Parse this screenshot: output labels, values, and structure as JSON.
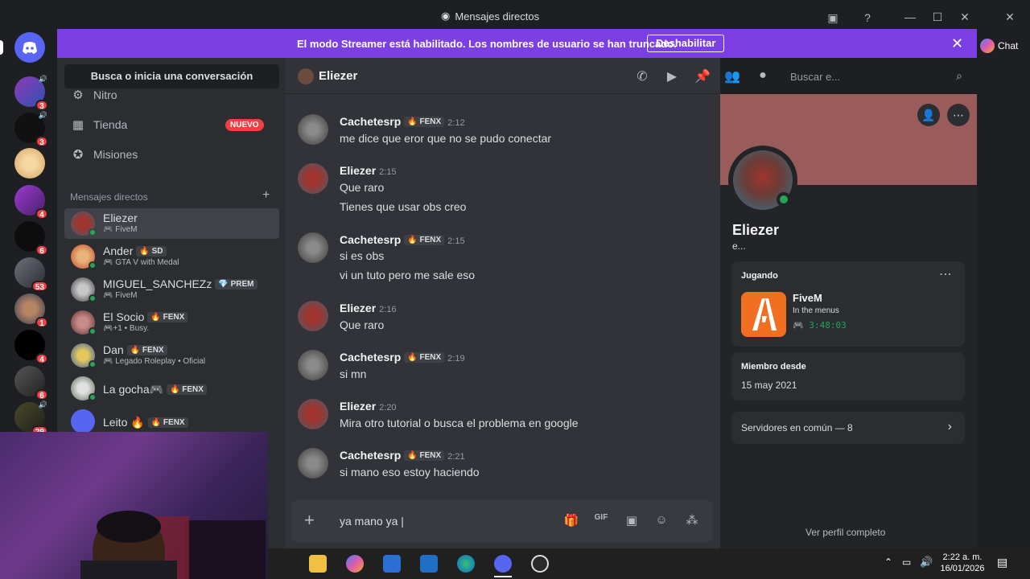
{
  "window": {
    "title": "Mensajes directos",
    "controls": [
      "minimize",
      "maximize",
      "close"
    ]
  },
  "banner": {
    "text": "El modo Streamer está habilitado. Los nombres de usuario se han truncado.",
    "button": "Deshabilitar"
  },
  "servers": [
    {
      "badge": "3"
    },
    {
      "badge": "3"
    },
    {
      "badge": ""
    },
    {
      "badge": "4"
    },
    {
      "badge": "6"
    },
    {
      "badge": "53"
    },
    {
      "badge": "1"
    },
    {
      "badge": "4"
    },
    {
      "badge": "6"
    },
    {
      "badge": "29"
    }
  ],
  "sidebar": {
    "search_label": "Busca o inicia una conversación",
    "nav": [
      {
        "label": "Nitro",
        "icon": "nitro-icon"
      },
      {
        "label": "Tienda",
        "icon": "shop-icon",
        "badge": "NUEVO"
      },
      {
        "label": "Misiones",
        "icon": "quests-icon"
      }
    ],
    "dm_header": "Mensajes directos",
    "dms": [
      {
        "name": "Eliezer",
        "sub": "FiveM",
        "tag": "",
        "active": true
      },
      {
        "name": "Ander",
        "sub": "GTA V with Medal",
        "tag": "SD"
      },
      {
        "name": "MIGUEL_SANCHEZz",
        "sub": "FiveM",
        "tag": "PREM"
      },
      {
        "name": "El Socio",
        "sub": "+1 • Busy.",
        "tag": "FENX"
      },
      {
        "name": "Dan",
        "sub": "Legado Roleplay • Oficial",
        "tag": "FENX"
      },
      {
        "name": "La gocha🎮",
        "sub": "",
        "tag": "FENX"
      },
      {
        "name": "Leito 🔥",
        "sub": "",
        "tag": "FENX"
      }
    ]
  },
  "chat": {
    "recipient": "Eliezer",
    "search_placeholder": "Buscar e...",
    "messages": [
      {
        "author": "Cachetesrp",
        "tag": "FENX",
        "time": "2:12",
        "lines": [
          "me dice que eror que no se pudo conectar"
        ]
      },
      {
        "author": "Eliezer",
        "tag": "",
        "time": "2:15",
        "lines": [
          "Que raro",
          "Tienes que usar obs creo"
        ]
      },
      {
        "author": "Cachetesrp",
        "tag": "FENX",
        "time": "2:15",
        "lines": [
          "si es obs",
          "vi un tuto pero me sale eso"
        ]
      },
      {
        "author": "Eliezer",
        "tag": "",
        "time": "2:16",
        "lines": [
          "Que raro"
        ]
      },
      {
        "author": "Cachetesrp",
        "tag": "FENX",
        "time": "2:19",
        "lines": [
          "si mn"
        ]
      },
      {
        "author": "Eliezer",
        "tag": "",
        "time": "2:20",
        "lines": [
          "Mira otro tutorial o busca el problema en google"
        ]
      },
      {
        "author": "Cachetesrp",
        "tag": "FENX",
        "time": "2:21",
        "lines": [
          "si mano eso estoy haciendo"
        ]
      }
    ],
    "composer_value": "ya mano ya"
  },
  "profile": {
    "name": "Eliezer",
    "subtitle": "e...",
    "activity_header": "Jugando",
    "game": "FiveM",
    "game_status": "In the menus",
    "game_time": "3:48:03",
    "member_header": "Miembro desde",
    "member_since": "15 may 2021",
    "servers_common": "Servidores en común — 8",
    "view_full": "Ver perfil completo"
  },
  "chat_button": "Chat",
  "taskbar": {
    "time": "2:22 a. m.",
    "date": "16/01/2026"
  },
  "colors": {
    "banner": "#7b3fe4",
    "online": "#23a55a",
    "badge": "#f23f43"
  }
}
